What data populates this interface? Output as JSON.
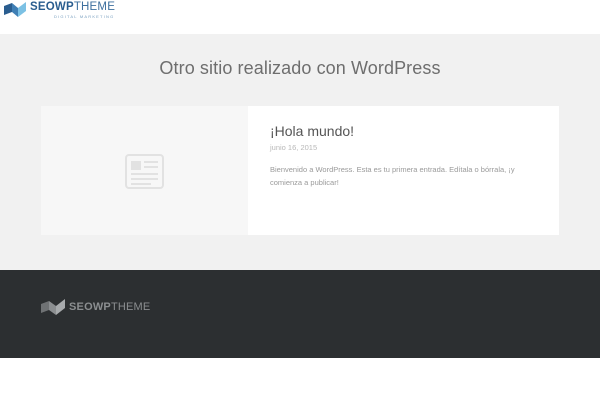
{
  "header": {
    "logo": {
      "brand_bold": "SEOWP",
      "brand_light": "THEME",
      "tagline": "DIGITAL MARKETING",
      "colors": {
        "primary": "#2a5d8f",
        "accent": "#7aa0c0"
      }
    }
  },
  "main": {
    "title": "Otro sitio realizado con WordPress",
    "background": "#f1f1f1",
    "post": {
      "thumbnail_icon": "document-icon",
      "title": "¡Hola mundo!",
      "date": "junio 16, 2015",
      "excerpt": "Bienvenido a WordPress. Esta es tu primera entrada. Edítala o bórrala, ¡y comienza a publicar!"
    }
  },
  "footer": {
    "background": "#2c2f31",
    "logo": {
      "brand_bold": "SEOWP",
      "brand_light": "THEME"
    }
  }
}
